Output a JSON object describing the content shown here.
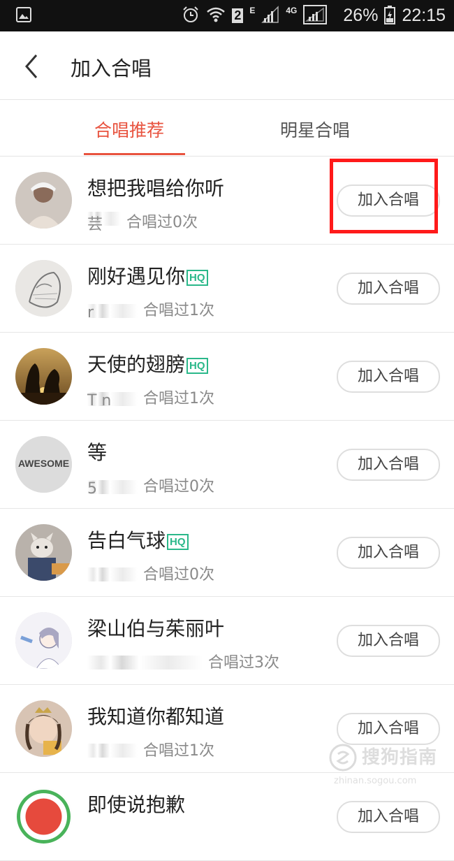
{
  "status_bar": {
    "sim_badge": "2",
    "network_e": "E",
    "network_4g": "4G",
    "battery": "26%",
    "time": "22:15",
    "icons": [
      "gallery-icon",
      "alarm-icon",
      "wifi-icon",
      "signal-icon",
      "battery-icon"
    ]
  },
  "header": {
    "title": "加入合唱",
    "back_icon": "chevron-left-icon"
  },
  "tabs": [
    {
      "label": "合唱推荐",
      "active": true
    },
    {
      "label": "明星合唱",
      "active": false
    }
  ],
  "accent_color": "#e8533f",
  "songs": [
    {
      "title": "想把我唱给你听",
      "hq": "",
      "user": "芸  ",
      "count": "合唱过0次",
      "button": "加入合唱"
    },
    {
      "title": "刚好遇见你",
      "hq": "HQ",
      "user": "r    ",
      "count": "合唱过1次",
      "button": "加入合唱"
    },
    {
      "title": "天使的翅膀",
      "hq": "HQ",
      "user": "T   n",
      "count": "合唱过1次",
      "button": "加入合唱"
    },
    {
      "title": "等",
      "hq": "",
      "user": "5    ",
      "count": "合唱过0次",
      "button": "加入合唱"
    },
    {
      "title": "告白气球",
      "hq": "HQ",
      "user": "    ",
      "count": "合唱过0次",
      "button": "加入合唱"
    },
    {
      "title": "梁山伯与茱丽叶",
      "hq": "",
      "user": "      ",
      "count": "合唱过3次",
      "button": "加入合唱"
    },
    {
      "title": "我知道你都知道",
      "hq": "",
      "user": "    ",
      "count": "合唱过1次",
      "button": "加入合唱"
    },
    {
      "title": "即使说抱歉",
      "hq": "",
      "user": "",
      "count": "",
      "button": "加入合唱"
    }
  ],
  "watermark": {
    "text": "搜狗指南",
    "url": "zhinan.sogou.com"
  }
}
